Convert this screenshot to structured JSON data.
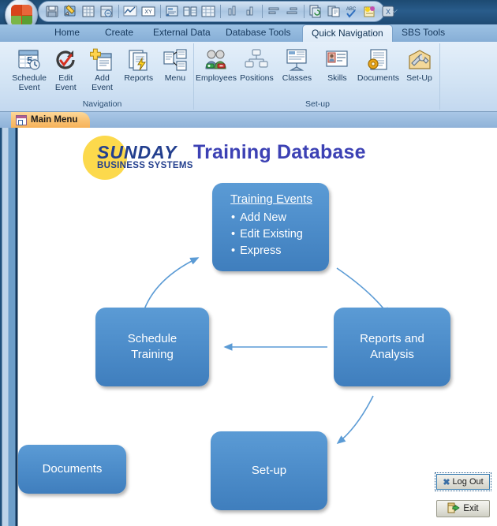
{
  "window": {
    "title": "",
    "app_icon": "access-orb-icon"
  },
  "quick_access_toolbar": {
    "icons": [
      "save-icon",
      "undo-edit-icon",
      "spelling-table-icon",
      "refresh-records-icon",
      "chart-line-icon",
      "datasheet-xy-icon",
      "form-view-icon",
      "split-form-icon",
      "tabular-layout-icon",
      "chart-column-small-icon",
      "chart-column-icon",
      "align-top-icon",
      "align-bottom-icon",
      "copy-refresh-icon",
      "paste-append-icon",
      "spell-check-icon",
      "filter-lamp-icon",
      "export-excel-icon"
    ],
    "dropdown_label": "⌵"
  },
  "ribbon": {
    "tabs": [
      {
        "label": "Home",
        "active": false
      },
      {
        "label": "Create",
        "active": false
      },
      {
        "label": "External Data",
        "active": false
      },
      {
        "label": "Database Tools",
        "active": false
      },
      {
        "label": "Quick Navigation",
        "active": true
      },
      {
        "label": "SBS Tools",
        "active": false
      }
    ],
    "groups": [
      {
        "label": "Navigation",
        "buttons": [
          {
            "caption": "Schedule\nEvent",
            "line1": "Schedule",
            "line2": "Event",
            "icon": "calendar-clock-icon"
          },
          {
            "caption": "Edit\nEvent",
            "line1": "Edit",
            "line2": "Event",
            "icon": "edit-refresh-icon"
          },
          {
            "caption": "Add\nEvent",
            "line1": "Add",
            "line2": "Event",
            "icon": "add-document-icon"
          },
          {
            "caption": "Reports",
            "line1": "Reports",
            "line2": "",
            "icon": "reports-lightning-icon"
          },
          {
            "caption": "Menu",
            "line1": "Menu",
            "line2": "",
            "icon": "menu-forms-icon"
          }
        ]
      },
      {
        "label": "Set-up",
        "buttons": [
          {
            "caption": "Employees",
            "line1": "Employees",
            "line2": "",
            "icon": "employees-icon"
          },
          {
            "caption": "Positions",
            "line1": "Positions",
            "line2": "",
            "icon": "org-chart-icon"
          },
          {
            "caption": "Classes",
            "line1": "Classes",
            "line2": "",
            "icon": "classes-presentation-icon"
          },
          {
            "caption": "Skills",
            "line1": "Skills",
            "line2": "",
            "icon": "skills-badge-icon"
          },
          {
            "caption": "Documents",
            "line1": "Documents",
            "line2": "",
            "icon": "documents-gear-icon"
          },
          {
            "caption": "Set-Up",
            "line1": "Set-Up",
            "line2": "",
            "icon": "setup-tools-icon"
          }
        ]
      }
    ]
  },
  "document_tabs": [
    {
      "label": "Main Menu",
      "icon": "form-icon",
      "active": true
    }
  ],
  "main": {
    "logo": {
      "brand": "SUNDAY",
      "tagline": "BUSINESS SYSTEMS",
      "circle_color": "#fcd94c",
      "text_color": "#233f8e"
    },
    "page_title": "Training Database",
    "page_title_color": "#3c41b4",
    "box_color": "#4e8ecb",
    "arrow_color": "#5b9bd5",
    "flow_boxes": [
      {
        "id": "training-events",
        "title": "Training Events",
        "bullets": [
          "Add New",
          "Edit Existing",
          "Express"
        ]
      },
      {
        "id": "schedule-training",
        "line1": "Schedule",
        "line2": "Training"
      },
      {
        "id": "reports-and-analysis",
        "line1": "Reports and",
        "line2": "Analysis"
      },
      {
        "id": "set-up",
        "line1": "Set-up",
        "line2": ""
      },
      {
        "id": "documents",
        "line1": "Documents",
        "line2": ""
      }
    ]
  },
  "footer": {
    "logout": {
      "label": "Log Out",
      "icon": "x-icon",
      "focused": true
    },
    "exit": {
      "label": "Exit",
      "icon": "exit-door-icon"
    }
  }
}
